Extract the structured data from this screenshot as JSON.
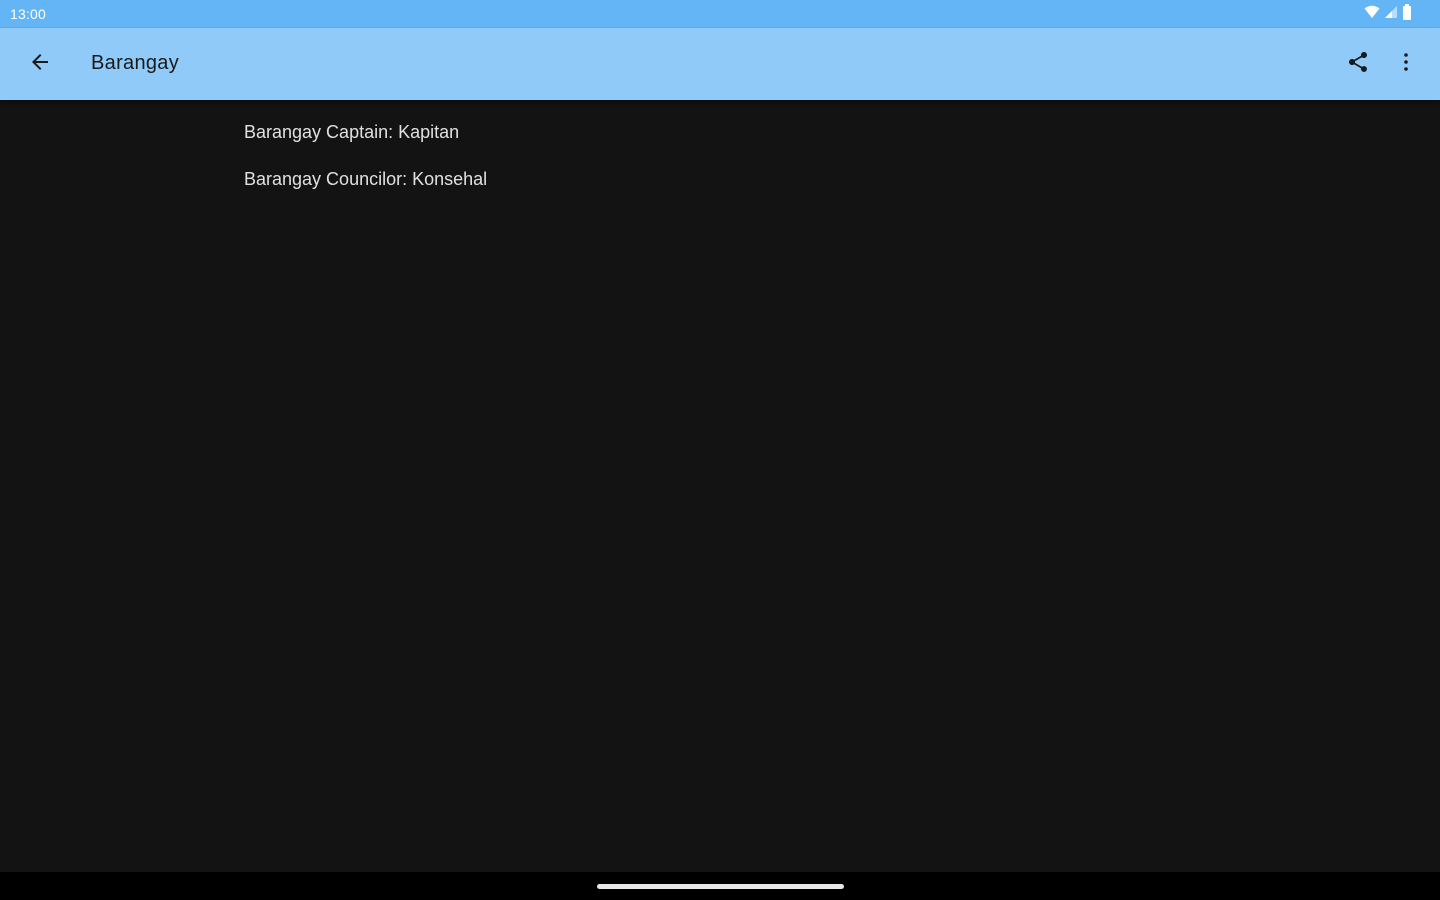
{
  "status_bar": {
    "time": "13:00",
    "icons": [
      "wifi-icon",
      "signal-icon",
      "battery-icon"
    ]
  },
  "app_bar": {
    "title": "Barangay",
    "back_icon": "arrow-back-icon",
    "share_icon": "share-icon",
    "more_icon": "more-vert-icon",
    "background": "#90caf9"
  },
  "content": {
    "items": [
      "Barangay Captain: Kapitan",
      "Barangay Councilor: Konsehal"
    ]
  },
  "colors": {
    "status_bar": "#64b5f6",
    "app_bar": "#90caf9",
    "background": "#131313",
    "text": "#e0e0e0"
  }
}
